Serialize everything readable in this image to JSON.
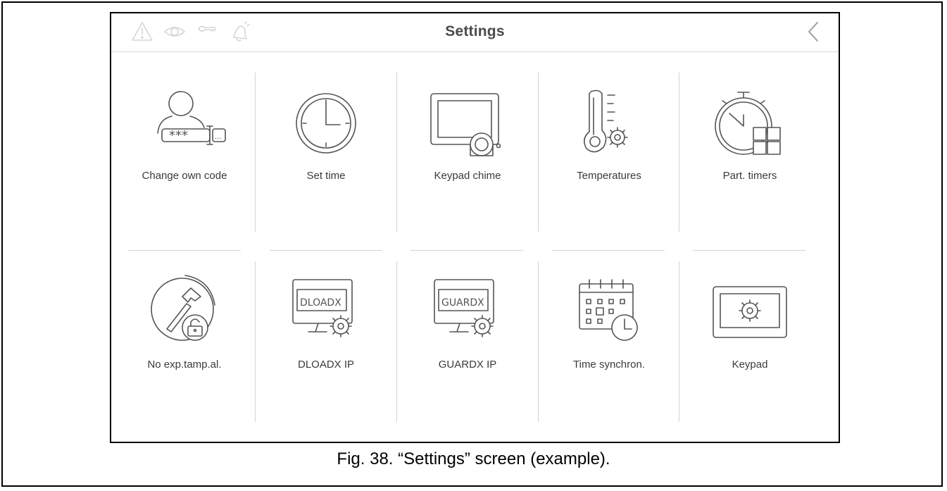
{
  "screen": {
    "title": "Settings",
    "status_icons": [
      "warning-icon",
      "eye-icon",
      "wrench-icon",
      "bell-icon"
    ],
    "back_icon": "chevron-left-icon",
    "tiles": [
      {
        "label": "Change own code",
        "icon": "user-code-icon"
      },
      {
        "label": "Set time",
        "icon": "clock-icon"
      },
      {
        "label": "Keypad chime",
        "icon": "keypad-chime-icon"
      },
      {
        "label": "Temperatures",
        "icon": "thermometer-gear-icon"
      },
      {
        "label": "Part. timers",
        "icon": "stopwatch-grid-icon"
      },
      {
        "label": "No exp.tamp.al.",
        "icon": "hammer-lock-icon"
      },
      {
        "label": "DLOADX IP",
        "icon": "monitor-gear-icon",
        "screen_text": "DLOADX"
      },
      {
        "label": "GUARDX IP",
        "icon": "monitor-gear-icon",
        "screen_text": "GUARDX"
      },
      {
        "label": "Time synchron.",
        "icon": "calendar-clock-icon"
      },
      {
        "label": "Keypad",
        "icon": "keypad-gear-icon"
      }
    ]
  },
  "caption": "Fig. 38. “Settings” screen (example)."
}
